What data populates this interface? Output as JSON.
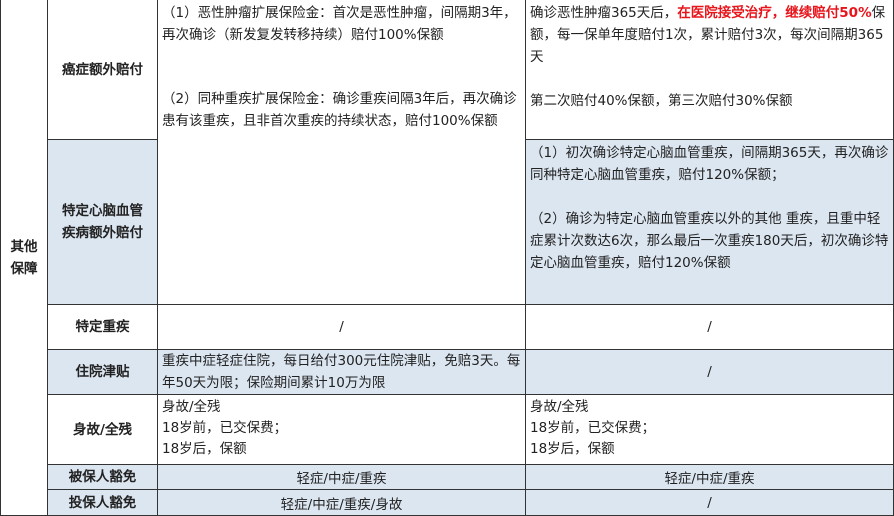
{
  "section_label": "其他保障",
  "rows": [
    {
      "label": "癌症额外赔付",
      "col_a": [
        "（1）恶性肿瘤扩展保险金：首次是恶性肿瘤，间隔期3年，再次确诊（新发复发转移持续）赔付100%保额",
        "（2）同种重疾扩展保险金：确诊重疾间隔3年后，再次确诊患有该重疾，且非首次重疾的持续状态，赔付100%保额"
      ],
      "col_b": {
        "part1": "确诊恶性肿瘤365天后，",
        "highlight": "在医院接受治疗，继续赔付50%",
        "part2": "保额，每一保单年度赔付1次，累计赔付3次，每次间隔期365天",
        "para2": "第二次赔付40%保额，第三次赔付30%保额"
      }
    },
    {
      "label": "特定心脑血管疾病额外赔付",
      "col_b": [
        "（1）初次确诊特定心脑血管重疾，间隔期365天，再次确诊同种特定心脑血管重疾，赔付120%保额；",
        "（2）确诊为特定心脑血管重疾以外的其他 重疾，且重中轻症累计次数达6次，那么最后一次重疾180天后，初次确诊特定心脑血管重疾，赔付120%保额"
      ]
    },
    {
      "label": "特定重疾",
      "col_a": "/",
      "col_b": "/"
    },
    {
      "label": "住院津贴",
      "col_a": "重疾中症轻症住院，每日给付300元住院津贴，免赔3天。每年50天为限；保险期间累计10万为限",
      "col_b": "/"
    },
    {
      "label": "身故/全残",
      "col_a": [
        "身故/全残",
        "18岁前，已交保费；",
        "18岁后，保额"
      ],
      "col_b": [
        "身故/全残",
        "18岁前，已交保费；",
        "18岁后，保额"
      ]
    },
    {
      "label": "被保人豁免",
      "col_a": "轻症/中症/重疾",
      "col_b": "轻症/中症/重疾"
    },
    {
      "label": "投保人豁免",
      "col_a": "轻症/中症/重疾/身故",
      "col_b": "/"
    }
  ],
  "colors": {
    "header_bg": "#dce6f1",
    "highlight": "#e8141b"
  }
}
